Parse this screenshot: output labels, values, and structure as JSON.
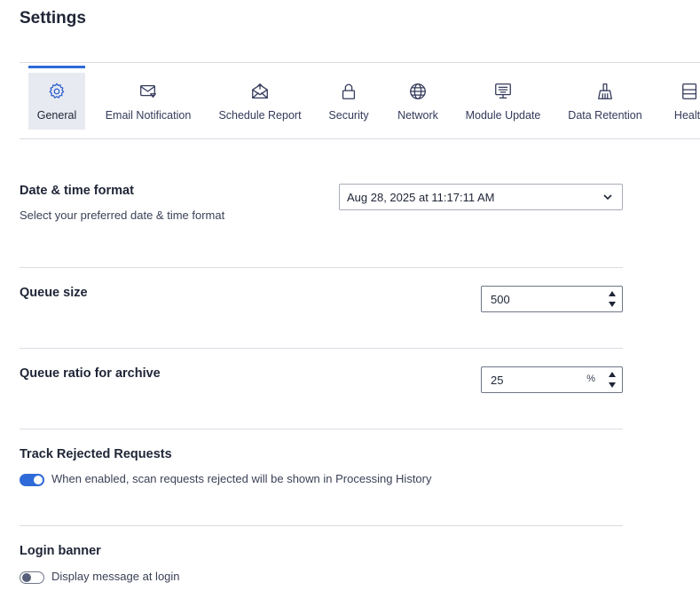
{
  "page": {
    "title": "Settings"
  },
  "tabs": [
    {
      "label": "General",
      "icon": "gear-icon",
      "active": true
    },
    {
      "label": "Email Notification",
      "icon": "email-notification-icon",
      "active": false
    },
    {
      "label": "Schedule Report",
      "icon": "schedule-report-icon",
      "active": false
    },
    {
      "label": "Security",
      "icon": "lock-icon",
      "active": false
    },
    {
      "label": "Network",
      "icon": "globe-icon",
      "active": false
    },
    {
      "label": "Module Update",
      "icon": "module-update-icon",
      "active": false
    },
    {
      "label": "Data Retention",
      "icon": "broom-icon",
      "active": false
    },
    {
      "label": "Health",
      "icon": "health-icon",
      "active": false
    }
  ],
  "general": {
    "datetime": {
      "title": "Date & time format",
      "description": "Select your preferred date & time format",
      "selected": "Aug 28, 2025 at 11:17:11 AM"
    },
    "queue_size": {
      "title": "Queue size",
      "value": "500"
    },
    "queue_ratio": {
      "title": "Queue ratio for archive",
      "value": "25",
      "unit": "%"
    },
    "track_rejected": {
      "title": "Track Rejected Requests",
      "toggle_label": "When enabled, scan requests rejected will be shown in Processing History",
      "enabled": true
    },
    "login_banner": {
      "title": "Login banner",
      "toggle_label": "Display message at login",
      "enabled": false
    }
  },
  "colors": {
    "accent": "#2f6bd8",
    "active_tab_bg": "#e7eaf1",
    "text": "#1f2536",
    "divider": "#dadce3"
  }
}
